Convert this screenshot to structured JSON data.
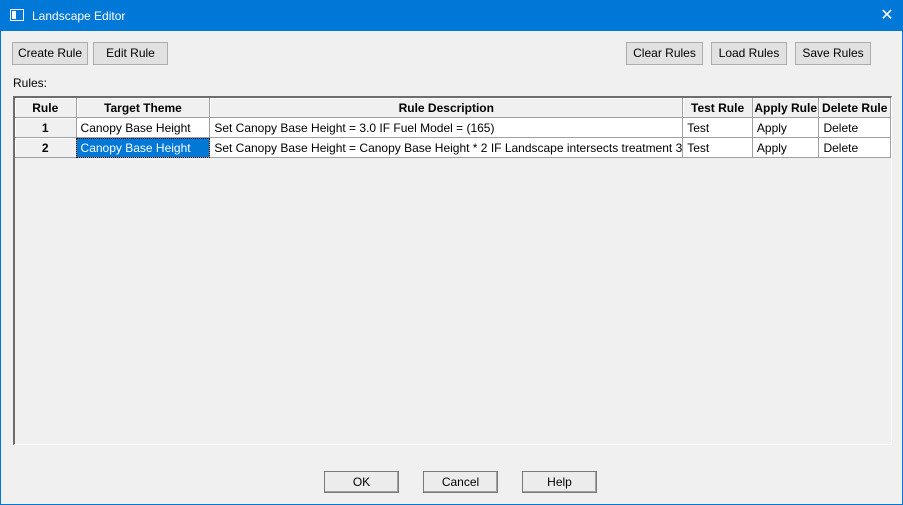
{
  "window": {
    "title": "Landscape Editor",
    "close_glyph": "✕"
  },
  "toolbar": {
    "create_rule": "Create Rule",
    "edit_rule": "Edit Rule",
    "clear_rules": "Clear Rules",
    "load_rules": "Load Rules",
    "save_rules": "Save Rules"
  },
  "rules_label": "Rules:",
  "table": {
    "columns": [
      "Rule",
      "Target Theme",
      "Rule Description",
      "Test Rule",
      "Apply Rule",
      "Delete Rule"
    ],
    "rows": [
      {
        "rule": "1",
        "target": "Canopy Base Height",
        "description": "Set Canopy Base Height = 3.0 IF Fuel Model = (165)",
        "test": "Test",
        "apply": "Apply",
        "delete": "Delete"
      },
      {
        "rule": "2",
        "target": "Canopy Base Height",
        "description": "Set Canopy Base Height = Canopy Base Height * 2 IF Landscape intersects treatment 3",
        "test": "Test",
        "apply": "Apply",
        "delete": "Delete"
      }
    ]
  },
  "footer": {
    "ok": "OK",
    "cancel": "Cancel",
    "help": "Help"
  }
}
